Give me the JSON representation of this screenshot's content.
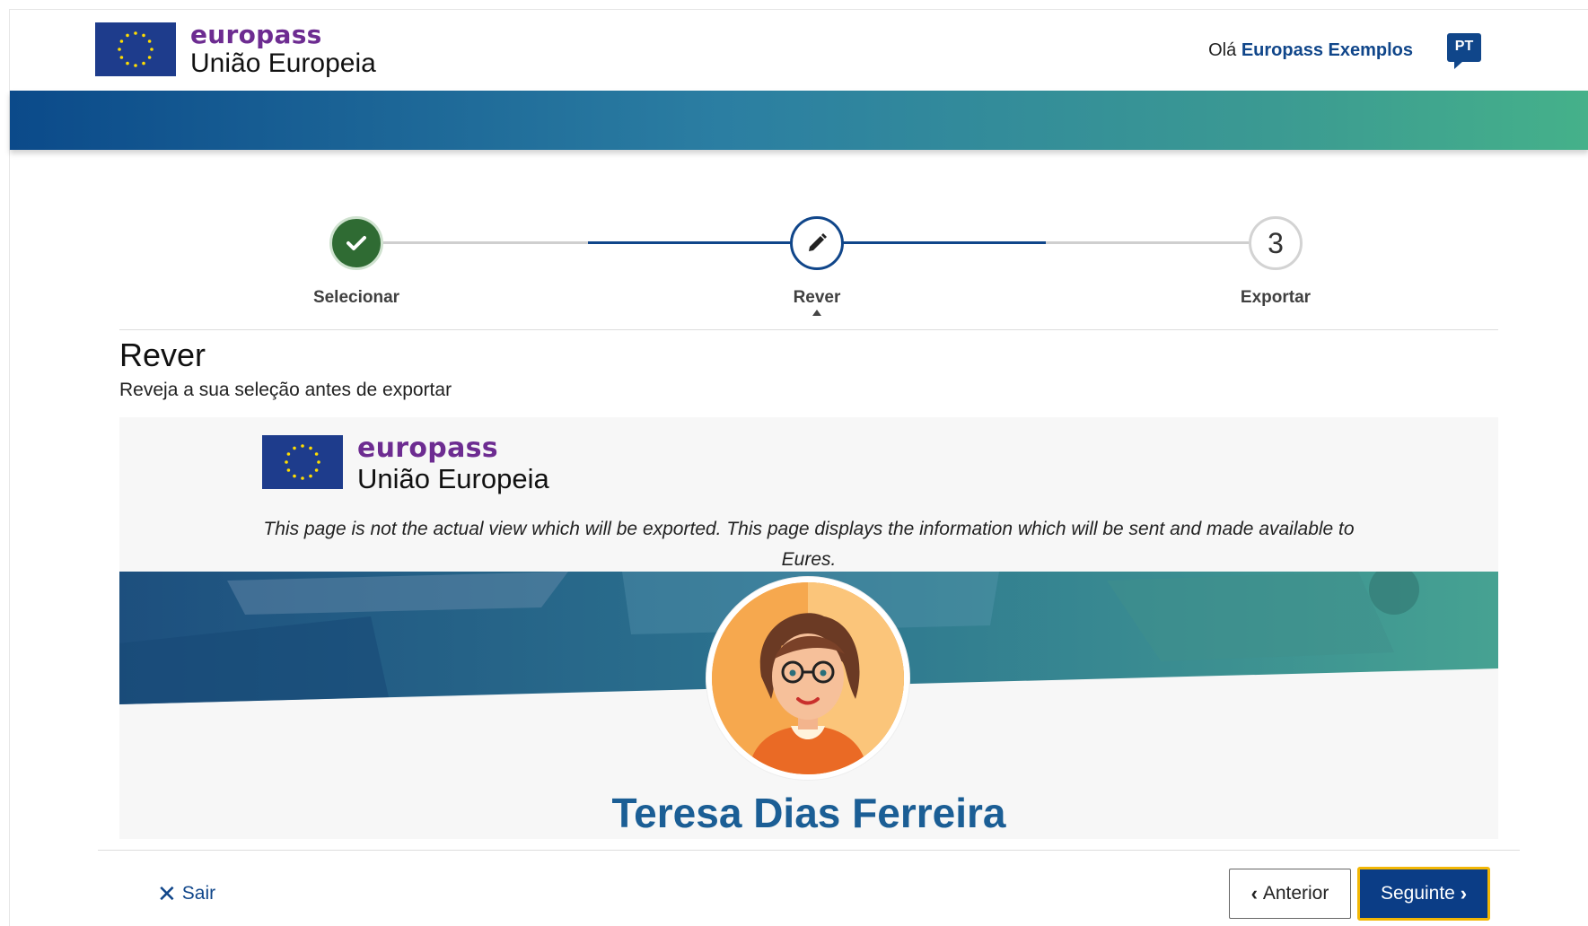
{
  "header": {
    "brand": "europass",
    "subtitle": "União Europeia",
    "greeting": "Olá",
    "user_name": "Europass Exemplos",
    "language": "PT"
  },
  "stepper": {
    "steps": [
      {
        "label": "Selecionar",
        "state": "completed"
      },
      {
        "label": "Rever",
        "state": "current"
      },
      {
        "label": "Exportar",
        "state": "pending",
        "number": "3"
      }
    ]
  },
  "page": {
    "title": "Rever",
    "subtitle": "Reveja a sua seleção antes de exportar"
  },
  "preview": {
    "brand": "europass",
    "subtitle": "União Europeia",
    "notice": "This page is not the actual view which will be exported. This page displays the information which will be sent and made available to Eures.",
    "person_name": "Teresa Dias Ferreira"
  },
  "footer": {
    "exit_label": "Sair",
    "prev_label": "Anterior",
    "next_label": "Seguinte"
  },
  "colors": {
    "brand_purple": "#6d2c91",
    "primary_blue": "#10468a",
    "completed_green": "#2f6b33",
    "focus_yellow": "#f2b705"
  }
}
